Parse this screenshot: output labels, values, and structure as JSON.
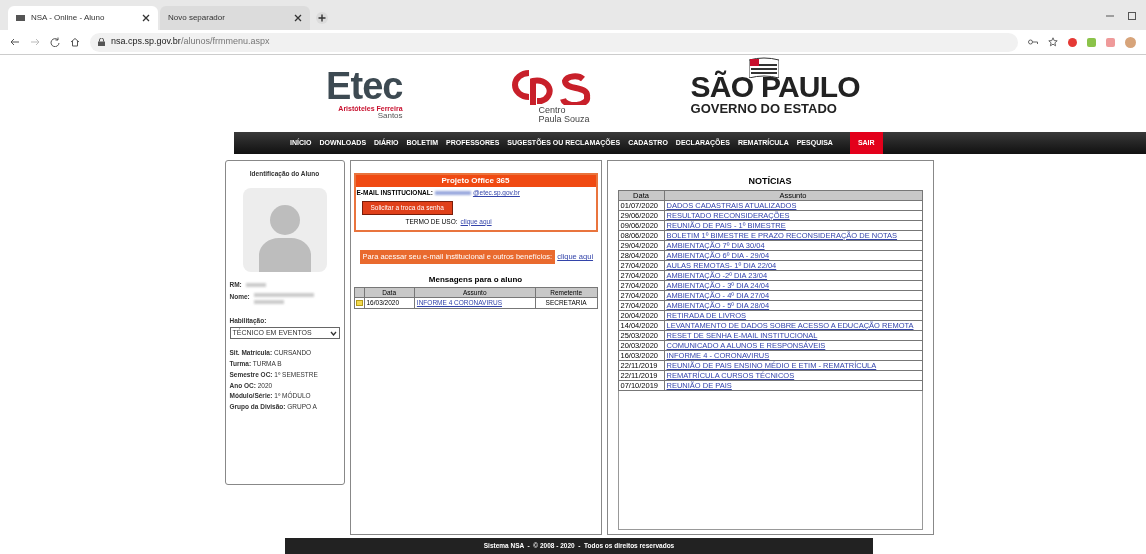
{
  "browser": {
    "tabs": [
      {
        "title": "NSA - Online - Aluno",
        "selected": true
      },
      {
        "title": "Novo separador",
        "selected": false
      }
    ],
    "address": {
      "domain": "nsa.cps.sp.gov.br",
      "path": "/alunos/frmmenu.aspx"
    }
  },
  "header": {
    "etec": {
      "name": "Etec",
      "school": "Aristóteles Ferreira",
      "city": "Santos"
    },
    "cps": {
      "line1": "Centro",
      "line2": "Paula Souza"
    },
    "sp": {
      "name": "SÃO PAULO",
      "sub": "GOVERNO DO ESTADO"
    }
  },
  "nav": [
    {
      "label": "INÍCIO",
      "highlighted": false
    },
    {
      "label": "DOWNLOADS",
      "highlighted": false
    },
    {
      "label": "DIÁRIO",
      "highlighted": false
    },
    {
      "label": "BOLETIM",
      "highlighted": false
    },
    {
      "label": "PROFESSORES",
      "highlighted": false
    },
    {
      "label": "SUGESTÕES OU RECLAMAÇÕES",
      "highlighted": false
    },
    {
      "label": "CADASTRO",
      "highlighted": false
    },
    {
      "label": "DECLARAÇÕES",
      "highlighted": false
    },
    {
      "label": "REMATRÍCULA",
      "highlighted": false
    },
    {
      "label": "PESQUISA",
      "highlighted": false
    },
    {
      "label": "SAIR",
      "highlighted": true
    }
  ],
  "student": {
    "title": "Identificação do Aluno",
    "rm_label": "RM:",
    "name_label": "Nome:",
    "habilitacao_label": "Habilitação:",
    "habilitacao": "TÉCNICO EM EVENTOS",
    "details": [
      {
        "label": "Sit. Matrícula:",
        "value": "CURSANDO"
      },
      {
        "label": "Turma:",
        "value": "TURMA B"
      },
      {
        "label": "Semestre OC:",
        "value": "1º SEMESTRE"
      },
      {
        "label": "Ano OC:",
        "value": "2020"
      },
      {
        "label": "Módulo/Série:",
        "value": "1º MÓDULO"
      },
      {
        "label": "Grupo da Divisão:",
        "value": "GRUPO A"
      }
    ]
  },
  "office": {
    "title": "Projeto Office 365",
    "email_label": "E-MAIL INSTITUCIONAL:",
    "email_domain": "@etec.sp.gov.br",
    "button": "Solicitar a troca da senha",
    "terms_label": "TERMO DE USO:",
    "terms_link": "clique aqui"
  },
  "promo": {
    "text": "Para acessar seu e-mail institucional e outros benefícios:",
    "link": "clique aqui"
  },
  "messages": {
    "title": "Mensagens para o aluno",
    "columns": [
      "Data",
      "Assunto",
      "Remetente"
    ],
    "rows": [
      {
        "date": "16/03/2020",
        "subject": "INFORME 4 CORONAVIRUS",
        "sender": "SECRETARIA"
      }
    ]
  },
  "news": {
    "title": "NOTÍCIAS",
    "columns": [
      "Data",
      "Assunto"
    ],
    "rows": [
      {
        "date": "01/07/2020",
        "subject": "DADOS CADASTRAIS ATUALIZADOS"
      },
      {
        "date": "29/06/2020",
        "subject": "RESULTADO RECONSIDERAÇÕES"
      },
      {
        "date": "09/06/2020",
        "subject": "REUNIÃO DE PAIS - 1º BIMESTRE"
      },
      {
        "date": "08/06/2020",
        "subject": "BOLETIM 1º BIMESTRE E PRAZO RECONSIDERAÇÃO DE NOTAS"
      },
      {
        "date": "29/04/2020",
        "subject": "AMBIENTAÇÃO 7º DIA 30/04"
      },
      {
        "date": "28/04/2020",
        "subject": "AMBIENTAÇÃO 6º DIA - 29/04"
      },
      {
        "date": "27/04/2020",
        "subject": "AULAS REMOTAS- 1º DIA 22/04"
      },
      {
        "date": "27/04/2020",
        "subject": "AMBIENTAÇÃO -2º DIA 23/04"
      },
      {
        "date": "27/04/2020",
        "subject": "AMBIENTAÇÃO - 3º DIA 24/04"
      },
      {
        "date": "27/04/2020",
        "subject": "AMBIENTAÇÃO - 4º DIA 27/04"
      },
      {
        "date": "27/04/2020",
        "subject": "AMBIENTAÇÃO - 5º DIA 28/04"
      },
      {
        "date": "20/04/2020",
        "subject": "RETIRADA DE LIVROS"
      },
      {
        "date": "14/04/2020",
        "subject": "LEVANTAMENTO DE DADOS SOBRE ACESSO A EDUCAÇÃO REMOTA"
      },
      {
        "date": "25/03/2020",
        "subject": "RESET DE SENHA E-MAIL INSTITUCIONAL"
      },
      {
        "date": "20/03/2020",
        "subject": "COMUNICADO A ALUNOS E RESPONSÁVEIS"
      },
      {
        "date": "16/03/2020",
        "subject": "INFORME 4 - CORONAVIRUS"
      },
      {
        "date": "22/11/2019",
        "subject": "REUNIÃO DE PAIS ENSINO MÉDIO E ETIM - REMATRÍCULA"
      },
      {
        "date": "22/11/2019",
        "subject": "REMATRÍCULA CURSOS TÉCNICOS"
      },
      {
        "date": "07/10/2019",
        "subject": "REUNIÃO DE PAIS"
      }
    ]
  },
  "footer": "Sistema NSA  -  © 2008 - 2020  -  Todos os direitos reservados"
}
